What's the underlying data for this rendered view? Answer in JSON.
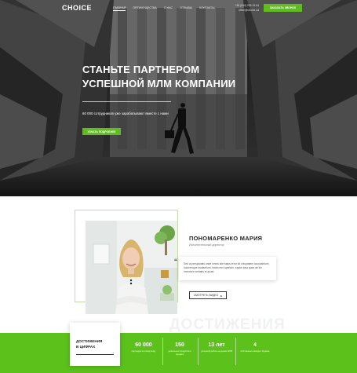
{
  "header": {
    "logo": "CHOICE",
    "nav": [
      "ГЛАВНАЯ",
      "ПРЕИМУЩЕСТВА",
      "О НАС",
      "ОТЗЫВЫ",
      "КОНТАКТЫ"
    ],
    "active_nav": "ГЛАВНАЯ",
    "phone": "+38 (044) 206 15 64",
    "email": "office@choice.ua",
    "order_button": "ЗАКАЗАТЬ ЗВОНОК"
  },
  "hero": {
    "title": "СТАНЬТЕ ПАРТНЕРОМ УСПЕШНОЙ МЛМ КОМПАНИИ",
    "subtitle": "60 000 сотрудников уже зарабатывают вместе с нами",
    "cta_button": "УЗНАТЬ ПОДРОБНЕЕ"
  },
  "person": {
    "name": "ПОНОМАРЕНКО МАРИЯ",
    "role": "Исполнительный директор",
    "quote": "Sed ut perspiciatis unde omnis iste natus error sit voluptatem accusantium doloremque laudantium, totam rem aperiam, eaque ipsa quae ab illo inventore veritatis et quasi.",
    "video_button": "СМОТРЕТЬ ВИДЕО"
  },
  "achievements": {
    "watermark": "ДОСТИЖЕНИЯ",
    "title_line1": "ДОСТИЖЕНИЯ",
    "title_line2": "В ЦИФРАХ",
    "stats": [
      {
        "value": "60 000",
        "label": "партнеров по всему миру"
      },
      {
        "value": "150",
        "label": "уникальных продуктов в продаже"
      },
      {
        "value": "13 лет",
        "label": "успешной работы на рынке МЛМ"
      },
      {
        "value": "4",
        "label": "собственных завода в Украине"
      }
    ]
  },
  "colors": {
    "accent": "#5fbe1e",
    "band": "#5cc11b",
    "dark": "#2a2a2a"
  },
  "icons": [
    "play-icon",
    "arrow-right-icon",
    "quote-icon"
  ]
}
